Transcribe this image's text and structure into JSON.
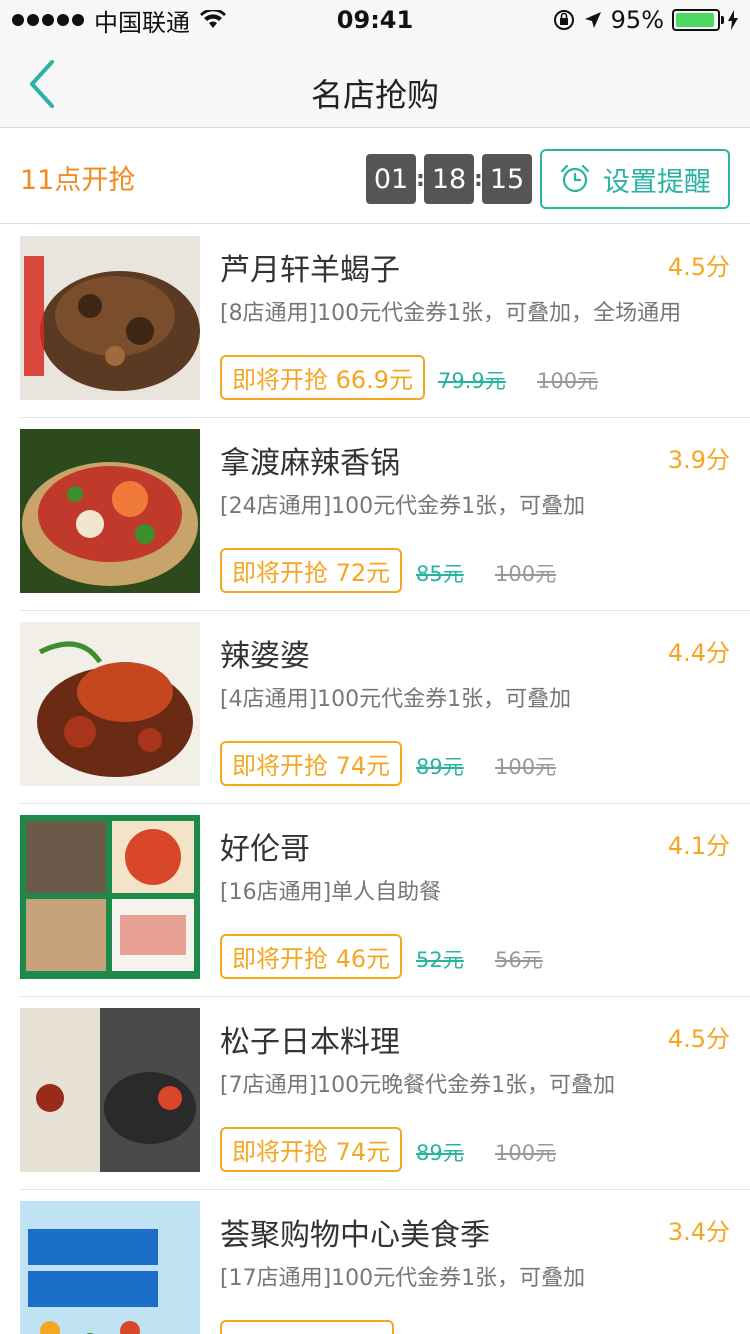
{
  "status_bar": {
    "carrier": "中国联通",
    "time": "09:41",
    "battery": "95%",
    "battery_level": 0.95,
    "battery_color": "#4cd964"
  },
  "nav": {
    "title": "名店抢购",
    "back_icon": "chevron-left-icon",
    "accent": "#29b3a3"
  },
  "timer": {
    "start_text": "11点开抢",
    "hours": "01",
    "minutes": "18",
    "seconds": "15",
    "remind_label": "设置提醒",
    "remind_icon": "alarm-clock-icon"
  },
  "deals": [
    {
      "name": "芦月轩羊蝎子",
      "rating": "4.5分",
      "desc": "[8店通用]100元代金券1张，可叠加，全场通用",
      "buy_label": "即将开抢 66.9元",
      "old_price": "79.9元",
      "orig_price": "100元"
    },
    {
      "name": "拿渡麻辣香锅",
      "rating": "3.9分",
      "desc": "[24店通用]100元代金券1张，可叠加",
      "buy_label": "即将开抢 72元",
      "old_price": "85元",
      "orig_price": "100元"
    },
    {
      "name": "辣婆婆",
      "rating": "4.4分",
      "desc": "[4店通用]100元代金券1张，可叠加",
      "buy_label": "即将开抢 74元",
      "old_price": "89元",
      "orig_price": "100元"
    },
    {
      "name": "好伦哥",
      "rating": "4.1分",
      "desc": "[16店通用]单人自助餐",
      "buy_label": "即将开抢 46元",
      "old_price": "52元",
      "orig_price": "56元"
    },
    {
      "name": "松子日本料理",
      "rating": "4.5分",
      "desc": "[7店通用]100元晚餐代金券1张，可叠加",
      "buy_label": "即将开抢 74元",
      "old_price": "89元",
      "orig_price": "100元"
    },
    {
      "name": "荟聚购物中心美食季",
      "rating": "3.4分",
      "desc": "[17店通用]100元代金券1张，可叠加",
      "buy_label": "",
      "old_price": "",
      "orig_price": ""
    }
  ],
  "colors": {
    "orange": "#f5a623",
    "teal": "#29b3a3",
    "timer_box": "#555555"
  }
}
